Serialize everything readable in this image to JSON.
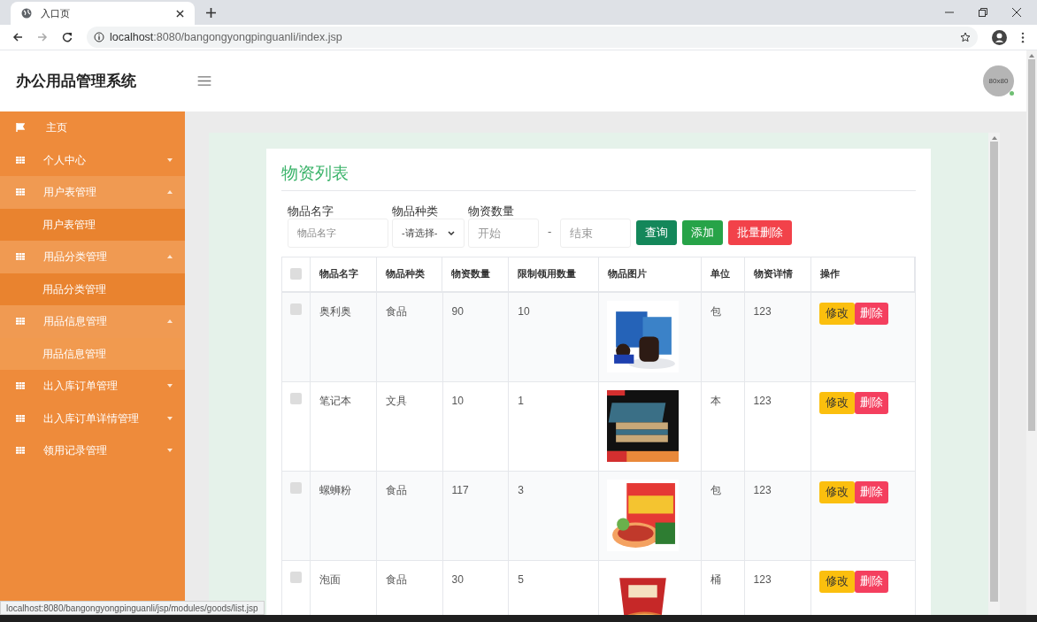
{
  "browser": {
    "tab_title": "入口页",
    "url_host": "localhost",
    "url_rest": ":8080/bangongyongpinguanli/index.jsp",
    "status_url": "localhost:8080/bangongyongpinguanli/jsp/modules/goods/list.jsp"
  },
  "header": {
    "title": "办公用品管理系统",
    "avatar_text": "80x80",
    "online": true
  },
  "sidebar": {
    "items": [
      {
        "kind": "home",
        "label": "主页"
      },
      {
        "kind": "menu",
        "label": "个人中心",
        "expanded": false
      },
      {
        "kind": "menu",
        "label": "用户表管理",
        "expanded": true,
        "children": [
          {
            "label": "用户表管理",
            "selected": false
          }
        ]
      },
      {
        "kind": "menu",
        "label": "用品分类管理",
        "expanded": true,
        "children": [
          {
            "label": "用品分类管理",
            "selected": false
          }
        ]
      },
      {
        "kind": "menu",
        "label": "用品信息管理",
        "expanded": true,
        "children": [
          {
            "label": "用品信息管理",
            "selected": true
          }
        ]
      },
      {
        "kind": "menu",
        "label": "出入库订单管理",
        "expanded": false
      },
      {
        "kind": "menu",
        "label": "出入库订单详情管理",
        "expanded": false
      },
      {
        "kind": "menu",
        "label": "领用记录管理",
        "expanded": false
      }
    ]
  },
  "panel": {
    "title": "物资列表",
    "filters": {
      "name_label": "物品名字",
      "name_placeholder": "物品名字",
      "type_label": "物品种类",
      "type_value": "-请选择-",
      "qty_label": "物资数量",
      "qty_from_placeholder": "开始",
      "qty_sep": "-",
      "qty_to_placeholder": "结束"
    },
    "buttons": [
      {
        "kind": "query",
        "label": "查询"
      },
      {
        "kind": "add",
        "label": "添加"
      },
      {
        "kind": "batch_delete",
        "label": "批量删除"
      }
    ],
    "table": {
      "select_all": false,
      "columns": [
        "物品名字",
        "物品种类",
        "物资数量",
        "限制领用数量",
        "物品图片",
        "单位",
        "物资详情",
        "操作"
      ],
      "rows": [
        {
          "checked": false,
          "name": "奥利奥",
          "type": "食品",
          "qty": "90",
          "limit": "10",
          "unit": "包",
          "detail": "123",
          "edit": "修改",
          "delete": "删除"
        },
        {
          "checked": false,
          "name": "笔记本",
          "type": "文具",
          "qty": "10",
          "limit": "1",
          "unit": "本",
          "detail": "123",
          "edit": "修改",
          "delete": "删除"
        },
        {
          "checked": false,
          "name": "螺蛳粉",
          "type": "食品",
          "qty": "117",
          "limit": "3",
          "unit": "包",
          "detail": "123",
          "edit": "修改",
          "delete": "删除"
        },
        {
          "checked": false,
          "name": "泡面",
          "type": "食品",
          "qty": "30",
          "limit": "5",
          "unit": "桶",
          "detail": "123",
          "edit": "修改",
          "delete": "删除"
        }
      ]
    }
  }
}
